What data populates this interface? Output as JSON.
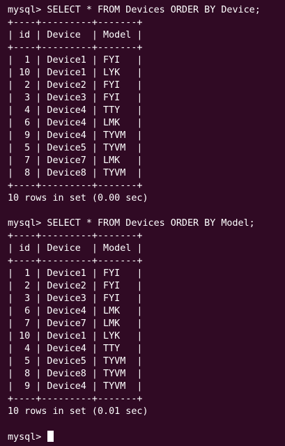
{
  "terminal": {
    "lines": [
      "mysql> SELECT * FROM Devices ORDER BY Device;",
      "+----+---------+-------+",
      "| id | Device  | Model |",
      "+----+---------+-------+",
      "|  1 | Device1 | FYI   |",
      "| 10 | Device1 | LYK   |",
      "|  2 | Device2 | FYI   |",
      "|  3 | Device3 | FYI   |",
      "|  4 | Device4 | TTY   |",
      "|  6 | Device4 | LMK   |",
      "|  9 | Device4 | TYVM  |",
      "|  5 | Device5 | TYVM  |",
      "|  7 | Device7 | LMK   |",
      "|  8 | Device8 | TYVM  |",
      "+----+---------+-------+",
      "10 rows in set (0.00 sec)",
      "",
      "mysql> SELECT * FROM Devices ORDER BY Model;",
      "+----+---------+-------+",
      "| id | Device  | Model |",
      "+----+---------+-------+",
      "|  1 | Device1 | FYI   |",
      "|  2 | Device2 | FYI   |",
      "|  3 | Device3 | FYI   |",
      "|  6 | Device4 | LMK   |",
      "|  7 | Device7 | LMK   |",
      "| 10 | Device1 | LYK   |",
      "|  4 | Device4 | TTY   |",
      "|  5 | Device5 | TYVM  |",
      "|  8 | Device8 | TYVM  |",
      "|  9 | Device4 | TYVM  |",
      "+----+---------+-------+",
      "10 rows in set (0.01 sec)",
      "",
      "mysql> "
    ],
    "colors": {
      "background": "#300a24",
      "foreground": "#ffffff"
    }
  }
}
